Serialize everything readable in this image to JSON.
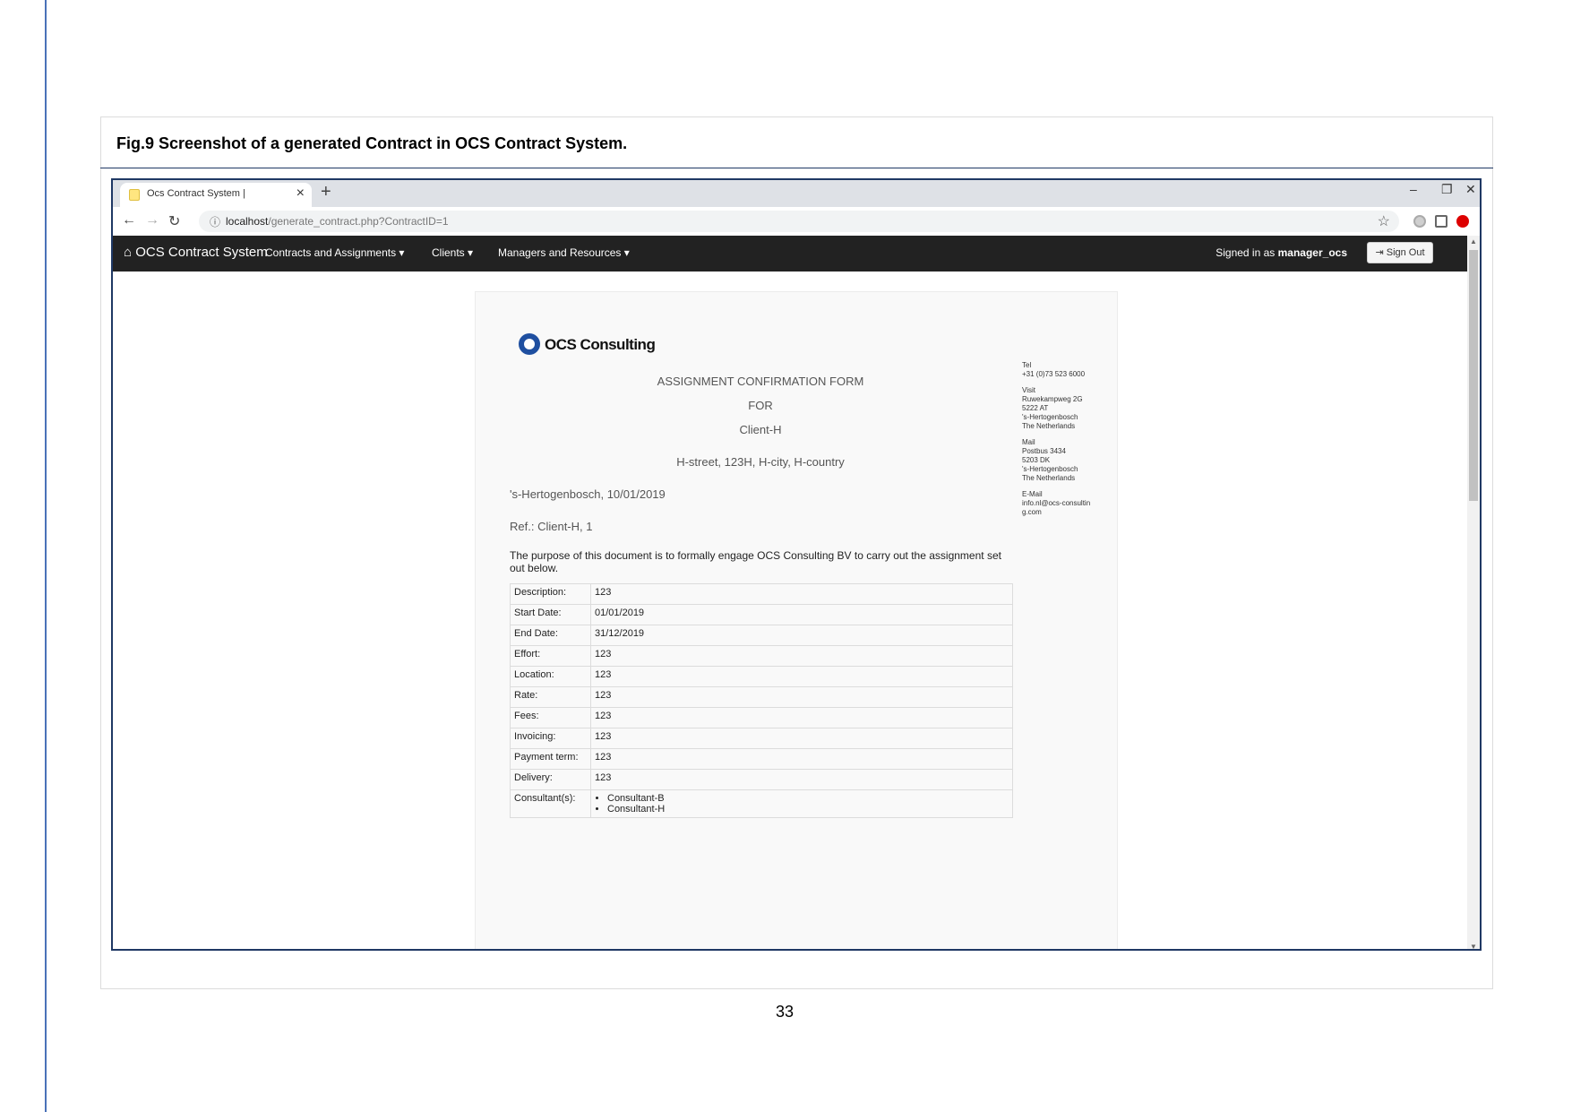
{
  "figure": {
    "caption": "Fig.9 Screenshot of a generated Contract in OCS Contract System."
  },
  "browser": {
    "tab_title": "Ocs Contract System |",
    "tab_close": "×",
    "new_tab": "+",
    "window_controls": {
      "minimize": "–",
      "restore": "❐",
      "close": "✕"
    },
    "url_host": "localhost",
    "url_path": "/generate_contract.php?ContractID=1",
    "icons": [
      "back-icon",
      "forward-icon",
      "reload-icon",
      "info-icon",
      "star-icon",
      "extension-icon",
      "adblock-icon",
      "menu-icon"
    ]
  },
  "navbar": {
    "brand": "OCS Contract System",
    "menus": [
      {
        "label": "Contracts and Assignments ▾"
      },
      {
        "label": "Clients ▾"
      },
      {
        "label": "Managers and Resources ▾"
      }
    ],
    "signed_in_prefix": "Signed in as ",
    "username": "manager_ocs",
    "sign_out": "Sign Out"
  },
  "document": {
    "logo_text": "OCS Consulting",
    "contact": {
      "tel_label": "Tel",
      "tel": "+31 (0)73 523 6000",
      "visit_label": "Visit",
      "visit_lines": [
        "Ruwekampweg 2G",
        "5222 AT",
        "'s-Hertogenbosch",
        "The Netherlands"
      ],
      "mail_label": "Mail",
      "mail_lines": [
        "Postbus 3434",
        "5203 DK",
        "'s-Hertogenbosch",
        "The Netherlands"
      ],
      "email_label": "E-Mail",
      "email": "info.nl@ocs-consulting.com"
    },
    "heading": "ASSIGNMENT CONFIRMATION FORM",
    "for": "FOR",
    "client": "Client-H",
    "address": "H-street, 123H, H-city, H-country",
    "place_date": "'s-Hertogenbosch, 10/01/2019",
    "ref": "Ref.: Client-H, 1",
    "purpose": "The purpose of this document is to formally engage OCS Consulting BV to carry out the assignment set out below.",
    "rows": [
      {
        "key": "Description:",
        "value": "123"
      },
      {
        "key": "Start Date:",
        "value": "01/01/2019"
      },
      {
        "key": "End Date:",
        "value": "31/12/2019"
      },
      {
        "key": "Effort:",
        "value": "123"
      },
      {
        "key": "Location:",
        "value": "123"
      },
      {
        "key": "Rate:",
        "value": "123"
      },
      {
        "key": "Fees:",
        "value": "123"
      },
      {
        "key": "Invoicing:",
        "value": "123"
      },
      {
        "key": "Payment term:",
        "value": "123"
      },
      {
        "key": "Delivery:",
        "value": "123"
      }
    ],
    "consultants_label": "Consultant(s):",
    "consultants": [
      "Consultant-B",
      "Consultant-H"
    ]
  },
  "page_number": "33"
}
